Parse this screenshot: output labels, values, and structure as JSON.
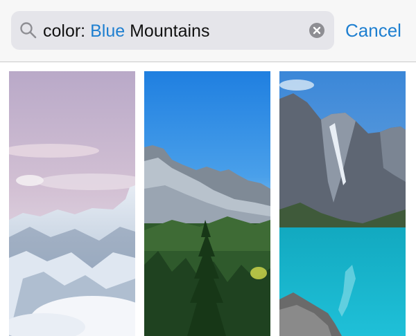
{
  "search": {
    "token_label": "color:",
    "token_value": "Blue",
    "query_text": "Mountains",
    "search_icon": "search-icon",
    "clear_icon": "clear-icon"
  },
  "cancel_label": "Cancel",
  "colors": {
    "accent": "#1e7fd0",
    "search_field": "#e5e5ea",
    "bar_background": "#f7f7f7"
  },
  "results": [
    {
      "name": "snowy-mountains-pink-sky"
    },
    {
      "name": "forest-mountains-blue-sky"
    },
    {
      "name": "turquoise-lake-mountains"
    }
  ]
}
